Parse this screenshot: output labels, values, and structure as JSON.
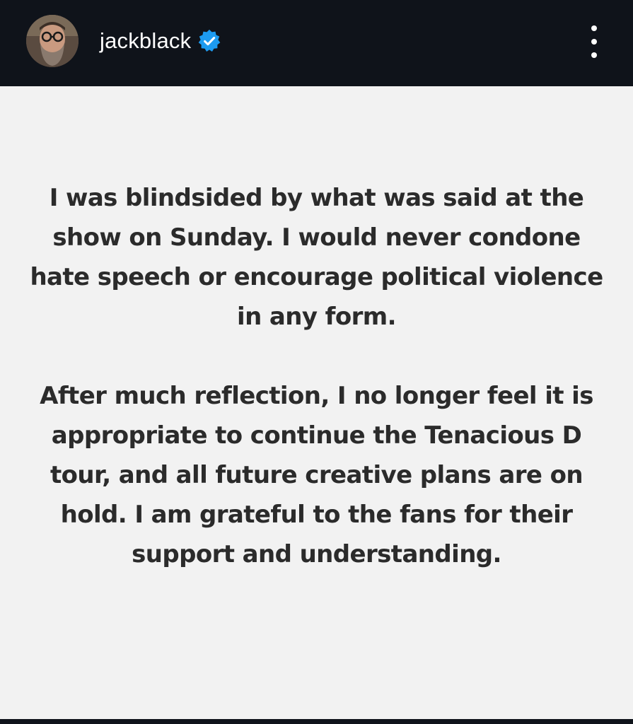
{
  "post": {
    "username": "jackblack",
    "verified": true,
    "avatar_icon": "profile-photo",
    "more_icon": "more-options-vertical-dots-icon",
    "paragraphs": [
      "I was blindsided by what was said at the show on Sunday. I would never condone hate speech or encourage political violence in any form.",
      "After much reflection, I no longer feel it is appropriate to continue the Tenacious D tour, and all future creative plans are on hold. I am grateful to the fans for their support and understanding."
    ]
  },
  "colors": {
    "header_bg": "#0f131a",
    "card_bg": "#f2f2f2",
    "text": "#2b2b2b",
    "verified_blue": "#1d9bf0"
  }
}
